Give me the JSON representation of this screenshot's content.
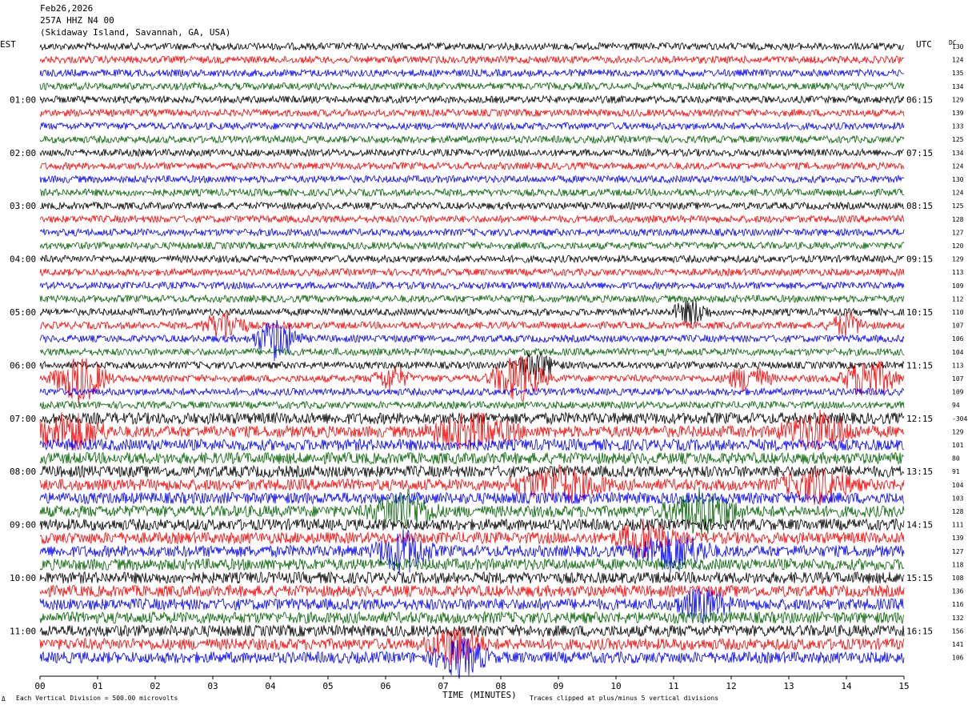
{
  "header": {
    "date": "Feb26,2026",
    "station": "257A HHZ N4 00",
    "location": "(Skidaway Island, Savannah, GA, USA)"
  },
  "left_tz": "EST",
  "right_tz": "UTC",
  "dc_label": "DC",
  "footer": {
    "scale": "Each Vertical Division =  500.00 microvolts",
    "clip": "Traces clipped at plus/minus 5 vertical divisions",
    "logo": "Δ"
  },
  "colors": [
    "#000000",
    "#ff0000",
    "#0000ff",
    "#006400"
  ],
  "chart_data": {
    "type": "line",
    "title": "257A HHZ N4 00",
    "xlabel": "TIME (MINUTES)",
    "ylabel": "",
    "x_ticks": [
      "00",
      "01",
      "02",
      "03",
      "04",
      "05",
      "06",
      "07",
      "08",
      "09",
      "10",
      "11",
      "12",
      "13",
      "14",
      "15"
    ],
    "xlim": [
      0,
      15
    ],
    "left_time_labels": [
      "01:00",
      "02:00",
      "03:00",
      "04:00",
      "05:00",
      "06:00",
      "07:00",
      "08:00",
      "09:00",
      "10:00",
      "11:00"
    ],
    "right_time_labels": [
      "06:15",
      "07:15",
      "08:15",
      "09:15",
      "10:15",
      "11:15",
      "12:15",
      "13:15",
      "14:15",
      "15:15",
      "16:15"
    ],
    "dc_offsets": [
      130,
      124,
      135,
      134,
      129,
      139,
      133,
      125,
      134,
      124,
      130,
      124,
      125,
      128,
      127,
      120,
      129,
      113,
      109,
      112,
      110,
      107,
      106,
      104,
      113,
      107,
      109,
      94,
      -304,
      129,
      101,
      80,
      91,
      104,
      103,
      128,
      111,
      139,
      127,
      118,
      108,
      136,
      116,
      132,
      156,
      141,
      106
    ],
    "line_colors": [
      "black",
      "red",
      "blue",
      "green"
    ],
    "bursts": [
      {
        "trace": 21,
        "minute": 3.2,
        "amp": 18,
        "width": 0.5
      },
      {
        "trace": 22,
        "minute": 4.1,
        "amp": 26,
        "width": 0.5
      },
      {
        "trace": 20,
        "minute": 11.3,
        "amp": 16,
        "width": 0.4
      },
      {
        "trace": 21,
        "minute": 14.0,
        "amp": 14,
        "width": 0.4
      },
      {
        "trace": 25,
        "minute": 0.7,
        "amp": 30,
        "width": 0.6
      },
      {
        "trace": 25,
        "minute": 8.3,
        "amp": 30,
        "width": 0.6
      },
      {
        "trace": 25,
        "minute": 6.1,
        "amp": 14,
        "width": 0.4
      },
      {
        "trace": 25,
        "minute": 12.3,
        "amp": 16,
        "width": 0.5
      },
      {
        "trace": 25,
        "minute": 14.4,
        "amp": 26,
        "width": 0.6
      },
      {
        "trace": 24,
        "minute": 8.6,
        "amp": 16,
        "width": 0.5
      },
      {
        "trace": 29,
        "minute": 0.5,
        "amp": 22,
        "width": 0.8
      },
      {
        "trace": 29,
        "minute": 7.5,
        "amp": 20,
        "width": 1.0
      },
      {
        "trace": 29,
        "minute": 13.5,
        "amp": 22,
        "width": 0.8
      },
      {
        "trace": 33,
        "minute": 9.0,
        "amp": 20,
        "width": 1.0
      },
      {
        "trace": 33,
        "minute": 13.5,
        "amp": 20,
        "width": 0.8
      },
      {
        "trace": 35,
        "minute": 6.3,
        "amp": 26,
        "width": 0.7
      },
      {
        "trace": 35,
        "minute": 11.5,
        "amp": 26,
        "width": 0.8
      },
      {
        "trace": 37,
        "minute": 10.5,
        "amp": 22,
        "width": 0.6
      },
      {
        "trace": 38,
        "minute": 6.3,
        "amp": 26,
        "width": 0.6
      },
      {
        "trace": 38,
        "minute": 11.0,
        "amp": 22,
        "width": 0.8
      },
      {
        "trace": 42,
        "minute": 11.5,
        "amp": 18,
        "width": 0.6
      },
      {
        "trace": 45,
        "minute": 7.2,
        "amp": 24,
        "width": 0.6
      },
      {
        "trace": 46,
        "minute": 7.3,
        "amp": 22,
        "width": 0.6
      }
    ]
  }
}
